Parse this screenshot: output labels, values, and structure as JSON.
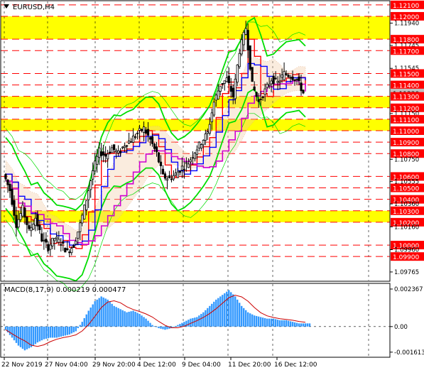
{
  "chart_title": "EURUSD,H4",
  "macd_title": "MACD(8,17,9) 0.000219 0.000477",
  "colors": {
    "candle": "#000000",
    "band_green": "#00dd00",
    "zone_yellow": "#ffff00",
    "level_red": "#ff0000",
    "ma_blue": "#0000ff",
    "ma_magenta": "#d000d0",
    "macd_hist": "#3399ff",
    "macd_signal": "#cc0000",
    "price_tag": "#ff0000",
    "current_tag": "#c0c0c0"
  },
  "price_levels": [
    {
      "label": "1.12100",
      "price": 1.121,
      "kind": "red"
    },
    {
      "label": "1.12000",
      "price": 1.12,
      "kind": "red"
    },
    {
      "label": "1.11940",
      "price": 1.1194,
      "kind": "axis"
    },
    {
      "label": "1.11800",
      "price": 1.118,
      "kind": "red"
    },
    {
      "label": "1.11745",
      "price": 1.11745,
      "kind": "axis"
    },
    {
      "label": "1.11700",
      "price": 1.117,
      "kind": "red"
    },
    {
      "label": "1.11545",
      "price": 1.11545,
      "kind": "axis"
    },
    {
      "label": "1.11500",
      "price": 1.115,
      "kind": "red"
    },
    {
      "label": "1.11400",
      "price": 1.114,
      "kind": "red"
    },
    {
      "label": "1.11330",
      "price": 1.1133,
      "kind": "current"
    },
    {
      "label": "1.11300",
      "price": 1.113,
      "kind": "red"
    },
    {
      "label": "1.11200",
      "price": 1.112,
      "kind": "red"
    },
    {
      "label": "1.11150",
      "price": 1.1115,
      "kind": "axis"
    },
    {
      "label": "1.11100",
      "price": 1.111,
      "kind": "red"
    },
    {
      "label": "1.11000",
      "price": 1.11,
      "kind": "red"
    },
    {
      "label": "1.10900",
      "price": 1.109,
      "kind": "red"
    },
    {
      "label": "1.10800",
      "price": 1.108,
      "kind": "red"
    },
    {
      "label": "1.10750",
      "price": 1.1075,
      "kind": "axis"
    },
    {
      "label": "1.10600",
      "price": 1.106,
      "kind": "red"
    },
    {
      "label": "1.10555",
      "price": 1.10555,
      "kind": "axis"
    },
    {
      "label": "1.10500",
      "price": 1.105,
      "kind": "red"
    },
    {
      "label": "1.10400",
      "price": 1.104,
      "kind": "red"
    },
    {
      "label": "1.10360",
      "price": 1.1036,
      "kind": "axis"
    },
    {
      "label": "1.10300",
      "price": 1.103,
      "kind": "red"
    },
    {
      "label": "1.10200",
      "price": 1.102,
      "kind": "red"
    },
    {
      "label": "1.10160",
      "price": 1.1016,
      "kind": "axis"
    },
    {
      "label": "1.10000",
      "price": 1.1,
      "kind": "red"
    },
    {
      "label": "1.09960",
      "price": 1.0996,
      "kind": "axis"
    },
    {
      "label": "1.09900",
      "price": 1.099,
      "kind": "red"
    },
    {
      "label": "1.09765",
      "price": 1.09765,
      "kind": "axis"
    }
  ],
  "zones": [
    {
      "from": 1.118,
      "to": 1.12
    },
    {
      "from": 1.112,
      "to": 1.113
    },
    {
      "from": 1.11,
      "to": 1.111
    },
    {
      "from": 1.102,
      "to": 1.103
    }
  ],
  "macd_axis": [
    "0.002367",
    "0.00",
    "-0.001613"
  ],
  "x_labels": [
    "22 Nov 2019",
    "27 Nov 04:00",
    "29 Nov 20:00",
    "4 Dec 12:00",
    "9 Dec 04:00",
    "11 Dec 20:00",
    "16 Dec 12:00"
  ],
  "chart_data": {
    "type": "candlestick",
    "symbol": "EURUSD",
    "timeframe": "H4",
    "ylim": [
      1.0969,
      1.1213
    ],
    "x": [
      "22 Nov 2019",
      "27 Nov 04:00",
      "29 Nov 20:00",
      "4 Dec 12:00",
      "9 Dec 04:00",
      "11 Dec 20:00",
      "16 Dec 12:00"
    ],
    "close_path": [
      1.1062,
      1.1048,
      1.1018,
      1.1032,
      1.1012,
      1.1024,
      1.1005,
      1.0998,
      1.1006,
      1.1002,
      1.0994,
      1.1,
      1.1018,
      1.104,
      1.1065,
      1.1082,
      1.1078,
      1.1085,
      1.108,
      1.1088,
      1.1092,
      1.1098,
      1.1102,
      1.1092,
      1.108,
      1.106,
      1.1058,
      1.1062,
      1.1068,
      1.1072,
      1.1082,
      1.109,
      1.1098,
      1.1125,
      1.114,
      1.1145,
      1.113,
      1.117,
      1.119,
      1.114,
      1.1125,
      1.1135,
      1.1145,
      1.1142,
      1.115,
      1.1148,
      1.1145,
      1.1133
    ],
    "macd_hist": [
      -0.0002,
      -0.0007,
      -0.0012,
      -0.0015,
      -0.0013,
      -0.001,
      -0.0008,
      -0.0007,
      -0.0007,
      -0.0006,
      -0.0005,
      -0.0003,
      0.0003,
      0.001,
      0.0016,
      0.0019,
      0.0017,
      0.0013,
      0.0011,
      0.0009,
      0.001,
      0.0008,
      0.0005,
      0.0001,
      -0.0001,
      -0.0002,
      -0.0001,
      0.0001,
      0.0003,
      0.0005,
      0.0006,
      0.0009,
      0.0013,
      0.0017,
      0.002,
      0.0023,
      0.0019,
      0.0013,
      0.0009,
      0.0007,
      0.0006,
      0.0005,
      0.0005,
      0.0004,
      0.0004,
      0.0003,
      0.0002,
      0.0002
    ],
    "macd_ylim": [
      -0.0018,
      0.0025
    ]
  }
}
